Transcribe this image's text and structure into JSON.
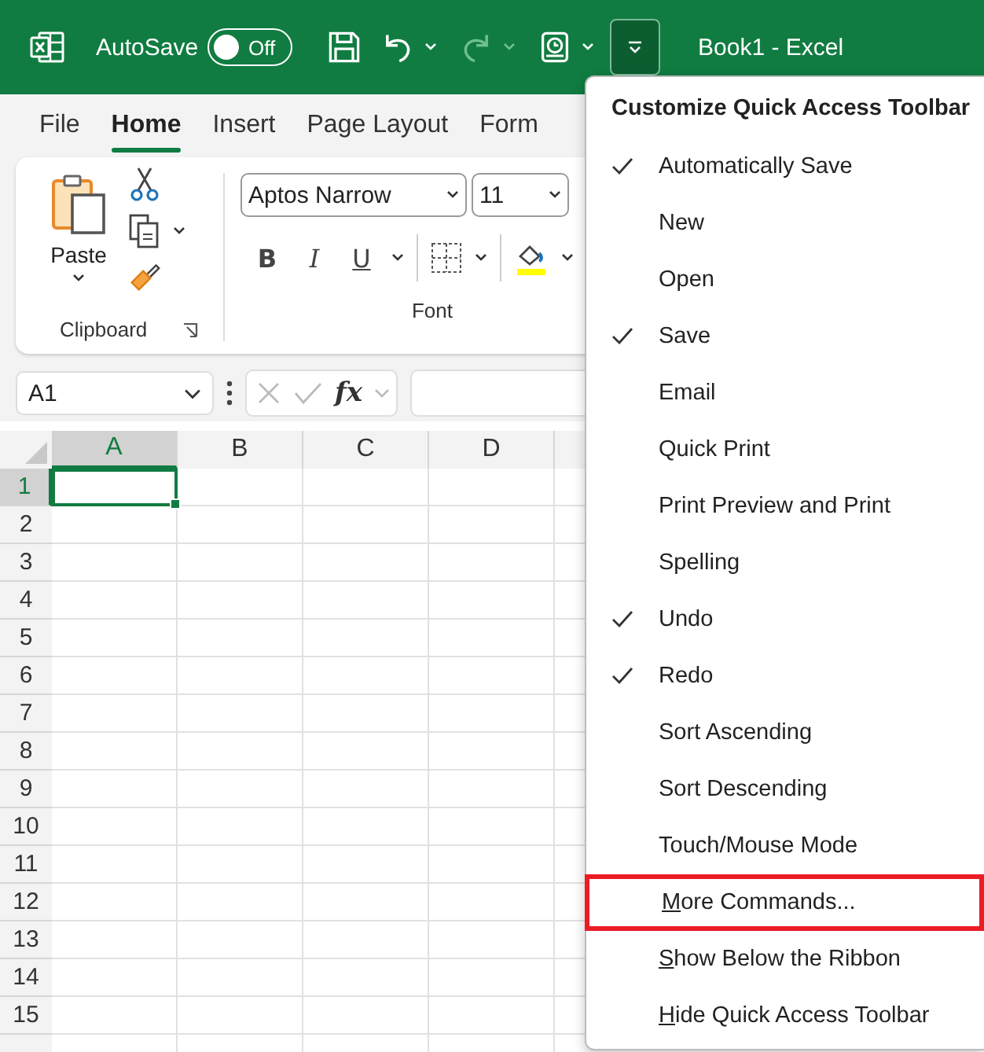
{
  "title_bar": {
    "autosave_label": "AutoSave",
    "autosave": {
      "on": false,
      "label": "Off"
    },
    "document_title": "Book1 - Excel"
  },
  "tabs": [
    {
      "label": "File",
      "selected": false
    },
    {
      "label": "Home",
      "selected": true
    },
    {
      "label": "Insert",
      "selected": false
    },
    {
      "label": "Page Layout",
      "selected": false
    },
    {
      "label": "Form",
      "selected": false
    }
  ],
  "ribbon": {
    "paste_label": "Paste",
    "font_name": "Aptos Narrow",
    "font_size": "11",
    "format_buttons": [
      "B",
      "I",
      "U"
    ],
    "groups": [
      "Clipboard",
      "Font"
    ]
  },
  "formula_bar": {
    "name_box": "A1",
    "function_label": "fx"
  },
  "columns": [
    {
      "label": "A",
      "selected": true
    },
    {
      "label": "B",
      "selected": false
    },
    {
      "label": "C",
      "selected": false
    },
    {
      "label": "D",
      "selected": false
    }
  ],
  "rows": [
    {
      "label": "1",
      "selected": true
    },
    {
      "label": "2",
      "selected": false
    },
    {
      "label": "3",
      "selected": false
    },
    {
      "label": "4",
      "selected": false
    },
    {
      "label": "5",
      "selected": false
    },
    {
      "label": "6",
      "selected": false
    },
    {
      "label": "7",
      "selected": false
    },
    {
      "label": "8",
      "selected": false
    },
    {
      "label": "9",
      "selected": false
    },
    {
      "label": "10",
      "selected": false
    },
    {
      "label": "11",
      "selected": false
    },
    {
      "label": "12",
      "selected": false
    },
    {
      "label": "13",
      "selected": false
    },
    {
      "label": "14",
      "selected": false
    },
    {
      "label": "15",
      "selected": false
    }
  ],
  "menu": {
    "title": "Customize Quick Access Toolbar",
    "items": [
      {
        "label": "Automatically Save",
        "checked": true,
        "underlined_initial": false,
        "outlined": false
      },
      {
        "label": "New",
        "checked": false,
        "underlined_initial": false,
        "outlined": false
      },
      {
        "label": "Open",
        "checked": false,
        "underlined_initial": false,
        "outlined": false
      },
      {
        "label": "Save",
        "checked": true,
        "underlined_initial": false,
        "outlined": false
      },
      {
        "label": "Email",
        "checked": false,
        "underlined_initial": false,
        "outlined": false
      },
      {
        "label": "Quick Print",
        "checked": false,
        "underlined_initial": false,
        "outlined": false
      },
      {
        "label": "Print Preview and Print",
        "checked": false,
        "underlined_initial": false,
        "outlined": false
      },
      {
        "label": "Spelling",
        "checked": false,
        "underlined_initial": false,
        "outlined": false
      },
      {
        "label": "Undo",
        "checked": true,
        "underlined_initial": false,
        "outlined": false
      },
      {
        "label": "Redo",
        "checked": true,
        "underlined_initial": false,
        "outlined": false
      },
      {
        "label": "Sort Ascending",
        "checked": false,
        "underlined_initial": false,
        "outlined": false
      },
      {
        "label": "Sort Descending",
        "checked": false,
        "underlined_initial": false,
        "outlined": false
      },
      {
        "label": "Touch/Mouse Mode",
        "checked": false,
        "underlined_initial": false,
        "outlined": false
      },
      {
        "label": "More Commands...",
        "checked": false,
        "underlined_initial": true,
        "outlined": true
      },
      {
        "label": "Show Below the Ribbon",
        "checked": false,
        "underlined_initial": true,
        "outlined": false
      },
      {
        "label": "Hide Quick Access Toolbar",
        "checked": false,
        "underlined_initial": true,
        "outlined": false
      }
    ]
  }
}
